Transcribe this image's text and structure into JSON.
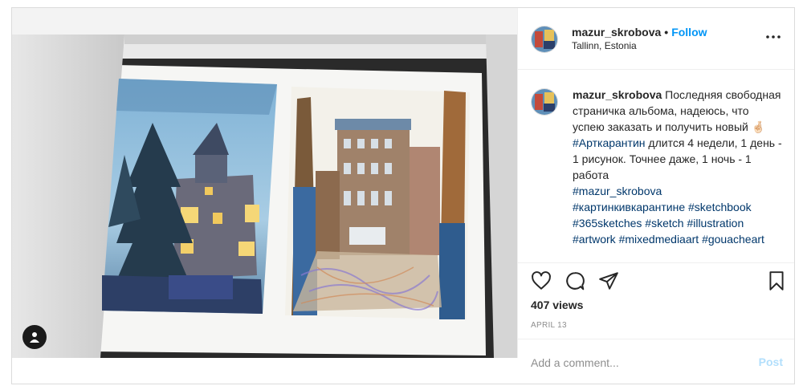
{
  "post": {
    "username": "mazur_skrobova",
    "separator": "•",
    "follow_label": "Follow",
    "location": "Tallinn, Estonia",
    "more_icon": "more-options-icon"
  },
  "caption": {
    "username": "mazur_skrobova",
    "text_1": "Последняя свободная страничка альбома, надеюсь, что успею заказать и получить новый",
    "emoji": "🤞🏻",
    "hashtag_1": "#Арткарантин",
    "text_2": "длится 4 недели, 1 день - 1 рисунок. Точнее даже, 1 ночь - 1 работа",
    "hashtags": [
      "#mazur_skrobova",
      "#картинкивкарантине",
      "#sketchbook",
      "#365sketches",
      "#sketch",
      "#illustration",
      "#artwork",
      "#mixedmediaart",
      "#gouacheart"
    ]
  },
  "actions": {
    "like_icon": "heart-icon",
    "comment_icon": "comment-icon",
    "share_icon": "paper-plane-icon",
    "save_icon": "bookmark-icon"
  },
  "stats": {
    "views": "407 views",
    "date": "APRIL 13"
  },
  "comment": {
    "placeholder": "Add a comment...",
    "post_label": "Post"
  },
  "colors": {
    "accent": "#0095f6",
    "hashtag": "#00376b",
    "muted": "#8e8e8e",
    "post_disabled": "#b2dffc"
  }
}
